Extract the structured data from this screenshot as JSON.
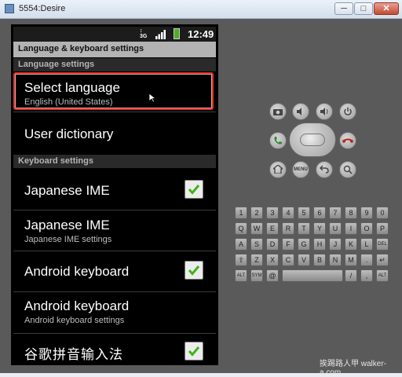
{
  "window": {
    "title": "5554:Desire",
    "min_label": "─",
    "max_label": "□",
    "close_label": "✕"
  },
  "status_bar": {
    "network": "3G",
    "network_sub": "↕",
    "time": "12:49"
  },
  "app_bar": {
    "title": "Language & keyboard settings"
  },
  "sections": {
    "language": "Language settings",
    "keyboard": "Keyboard settings"
  },
  "items": [
    {
      "title": "Select language",
      "summary": "English (United States)"
    },
    {
      "title": "User dictionary"
    },
    {
      "title": "Japanese IME",
      "checked": true
    },
    {
      "title": "Japanese IME",
      "summary": "Japanese IME settings"
    },
    {
      "title": "Android keyboard",
      "checked": true
    },
    {
      "title": "Android keyboard",
      "summary": "Android keyboard settings"
    },
    {
      "title": "谷歌拼音输入法",
      "checked": true
    }
  ],
  "controls": {
    "camera_icon": "camera-icon",
    "volume_down_icon": "volume-down-icon",
    "volume_up_icon": "volume-up-icon",
    "power_icon": "power-icon",
    "call_icon": "call-icon",
    "end_call_icon": "end-call-icon",
    "home_icon": "home-icon",
    "menu_label": "MENU",
    "back_icon": "back-icon",
    "search_icon": "search-icon"
  },
  "keyboard": {
    "row1": [
      "1",
      "2",
      "3",
      "4",
      "5",
      "6",
      "7",
      "8",
      "9",
      "0"
    ],
    "row2": [
      "Q",
      "W",
      "E",
      "R",
      "T",
      "Y",
      "U",
      "I",
      "O",
      "P"
    ],
    "row3": [
      "A",
      "S",
      "D",
      "F",
      "G",
      "H",
      "J",
      "K",
      "L",
      "DEL"
    ],
    "row4": [
      "⇧",
      "Z",
      "X",
      "C",
      "V",
      "B",
      "N",
      "M",
      ".",
      "↵"
    ],
    "row5_left": [
      "ALT",
      "SYM",
      "@"
    ],
    "row5_right": [
      "/",
      ",",
      "ALT"
    ]
  },
  "watermark": "挨踢路人甲 walker-a.com"
}
